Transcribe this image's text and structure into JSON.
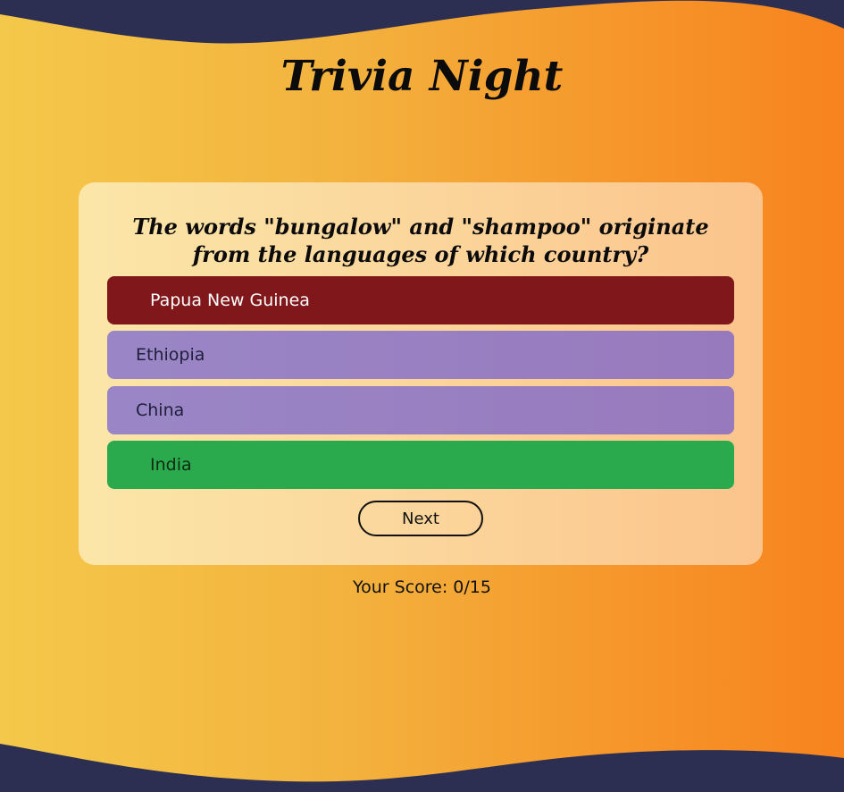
{
  "app": {
    "title": "Trivia Night"
  },
  "quiz": {
    "question": "The words \"bungalow\" and \"shampoo\" originate from the languages of which country?",
    "answers": [
      {
        "label": "Papua New Guinea",
        "state": "wrong"
      },
      {
        "label": "Ethiopia",
        "state": "neutral"
      },
      {
        "label": "China",
        "state": "neutral"
      },
      {
        "label": "India",
        "state": "correct"
      }
    ],
    "next_label": "Next"
  },
  "score": {
    "label": "Your Score:",
    "value": "0/15"
  },
  "colors": {
    "background_start": "#f4c84a",
    "background_end": "#f7831e",
    "wave": "#2d2f52",
    "card": "#fbd69c",
    "wrong_answer": "#80171a",
    "neutral_answer": "#9a86c6",
    "correct_answer": "#2aaa4c"
  }
}
